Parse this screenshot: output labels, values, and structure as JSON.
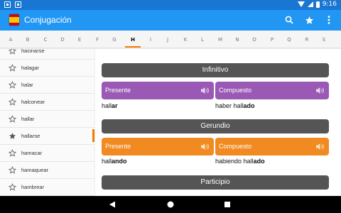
{
  "status_bar": {
    "time": "9:16",
    "icons": [
      "wifi-icon",
      "signal-icon",
      "battery-icon"
    ]
  },
  "app_bar": {
    "title": "Conjugación",
    "icon": "spain-flag-icon",
    "actions": [
      "search-icon",
      "star-icon",
      "more-vert-icon"
    ]
  },
  "letters": {
    "items": [
      "A",
      "B",
      "C",
      "D",
      "E",
      "F",
      "G",
      "H",
      "I",
      "J",
      "K",
      "L",
      "M",
      "N",
      "O",
      "P",
      "Q",
      "R",
      "S"
    ],
    "active": "H"
  },
  "verb_list": {
    "items": [
      {
        "label": "hacinarse",
        "starred": false,
        "selected": false
      },
      {
        "label": "halagar",
        "starred": false,
        "selected": false
      },
      {
        "label": "halar",
        "starred": false,
        "selected": false
      },
      {
        "label": "halconear",
        "starred": false,
        "selected": false
      },
      {
        "label": "hallar",
        "starred": false,
        "selected": false
      },
      {
        "label": "hallarse",
        "starred": true,
        "selected": true
      },
      {
        "label": "hamacar",
        "starred": false,
        "selected": false
      },
      {
        "label": "hamaquear",
        "starred": false,
        "selected": false
      },
      {
        "label": "hambrear",
        "starred": false,
        "selected": false
      }
    ]
  },
  "conjugation": {
    "infinitivo": {
      "header": "Infinitivo",
      "presente_label": "Presente",
      "compuesto_label": "Compuesto",
      "presente_stem": "hall",
      "presente_ending": "ar",
      "compuesto_prefix": "haber hall",
      "compuesto_ending": "ado"
    },
    "gerundio": {
      "header": "Gerundio",
      "presente_label": "Presente",
      "compuesto_label": "Compuesto",
      "presente_stem": "hall",
      "presente_ending": "ando",
      "compuesto_prefix": "habiendo hall",
      "compuesto_ending": "ado"
    },
    "participio": {
      "header": "Participio"
    }
  },
  "colors": {
    "status_bar": "#1976d2",
    "app_bar": "#2196f3",
    "accent": "#f57c00",
    "infinitivo_button": "#9b59b6",
    "gerundio_button": "#f18a21",
    "section_header": "#555555"
  }
}
